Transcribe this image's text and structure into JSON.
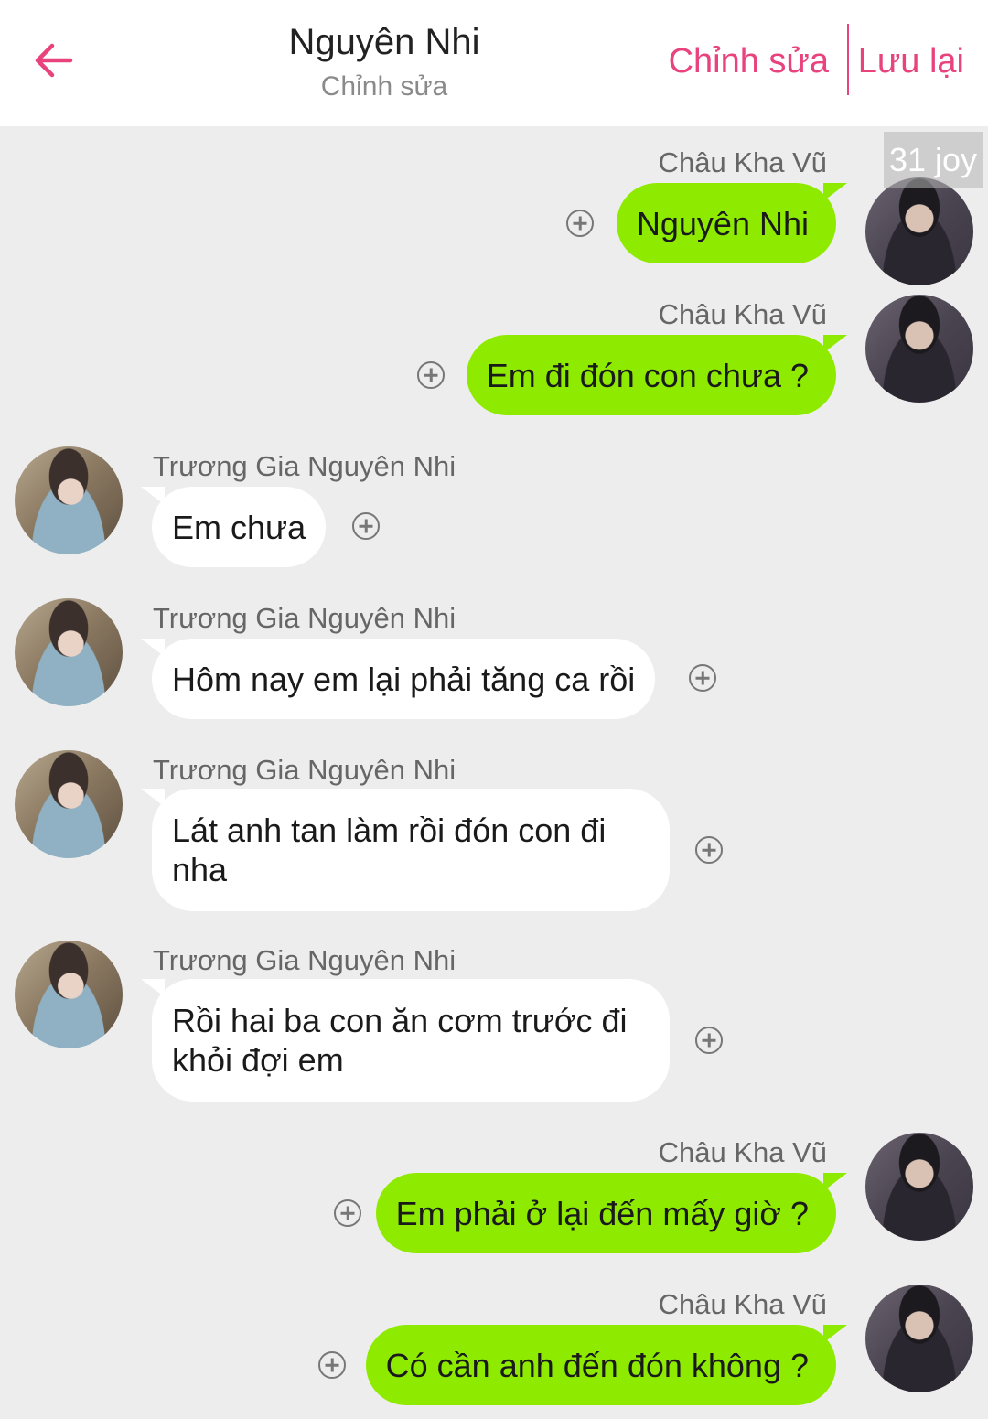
{
  "header": {
    "title": "Nguyên Nhi",
    "subtitle": "Chỉnh sửa",
    "edit_label": "Chỉnh sửa",
    "save_label": "Lưu lại"
  },
  "watermark": "31 joy",
  "messages": [
    {
      "side": "right",
      "sender": "Châu Kha Vũ",
      "text": "Nguyên Nhi"
    },
    {
      "side": "right",
      "sender": "Châu Kha Vũ",
      "text": "Em đi đón con chưa ?"
    },
    {
      "side": "left",
      "sender": "Trương Gia Nguyên Nhi",
      "text": "Em chưa"
    },
    {
      "side": "left",
      "sender": "Trương Gia Nguyên Nhi",
      "text": "Hôm nay em lại phải tăng ca rồi"
    },
    {
      "side": "left",
      "sender": "Trương Gia Nguyên Nhi",
      "text": "Lát anh tan làm rồi đón con đi nha"
    },
    {
      "side": "left",
      "sender": "Trương Gia Nguyên Nhi",
      "text": "Rồi hai ba con ăn cơm trước đi khỏi đợi em"
    },
    {
      "side": "right",
      "sender": "Châu Kha Vũ",
      "text": "Em phải ở lại đến mấy giờ ?"
    },
    {
      "side": "right",
      "sender": "Châu Kha Vũ",
      "text": "Có cần anh đến đón không ?"
    }
  ],
  "colors": {
    "accent": "#e8437d",
    "sent_bubble": "#8eeb00",
    "received_bubble": "#ffffff",
    "background": "#ededed"
  },
  "icons": {
    "back": "arrow-left-icon",
    "add": "plus-circle-icon"
  }
}
